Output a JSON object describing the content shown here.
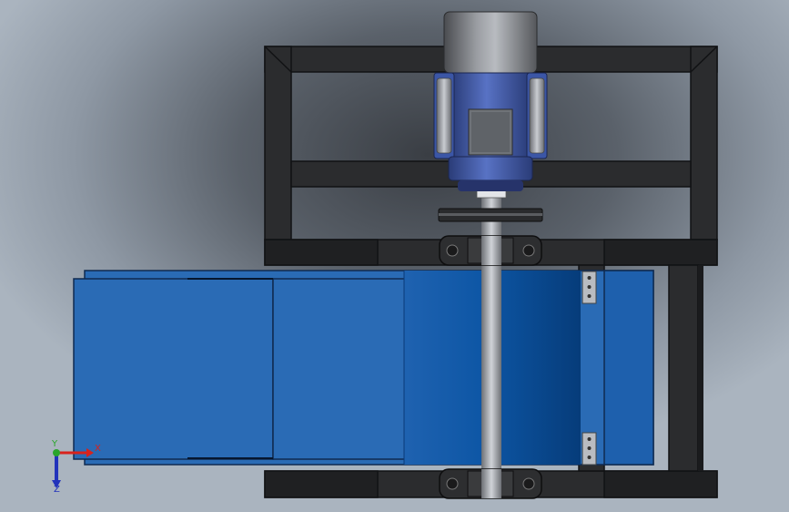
{
  "viewport": {
    "colors": {
      "background_dark": "#3a3e44",
      "background_light": "#aab4bf",
      "frame_steel": "#2b2c2e",
      "frame_edge": "#111214",
      "motor_blue": "#3f5aa8",
      "motor_grey": "#8a8d92",
      "conveyor_blue": "#2a6bb5",
      "roller_blue": "#0c4e97"
    },
    "triad": {
      "x_label": "X",
      "y_label": "Y",
      "z_label": "Z",
      "x_color": "#d8221c",
      "y_color": "#2aa52a",
      "z_color": "#2233bb"
    }
  }
}
